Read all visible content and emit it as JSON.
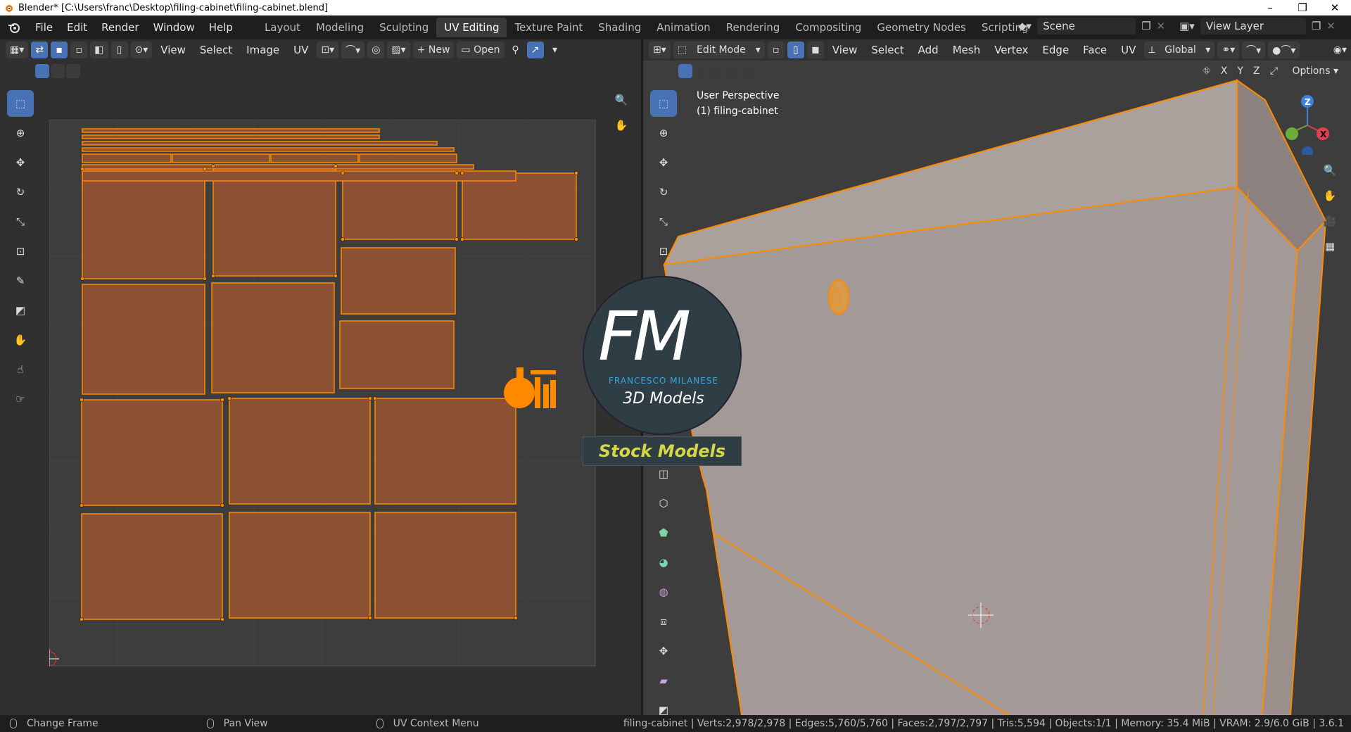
{
  "window": {
    "title": "Blender* [C:\\Users\\franc\\Desktop\\filing-cabinet\\filing-cabinet.blend]",
    "min": "–",
    "max": "❐",
    "close": "✕"
  },
  "menu": [
    "File",
    "Edit",
    "Render",
    "Window",
    "Help"
  ],
  "workspaces": [
    {
      "label": "Layout"
    },
    {
      "label": "Modeling"
    },
    {
      "label": "Sculpting"
    },
    {
      "label": "UV Editing",
      "active": true
    },
    {
      "label": "Texture Paint"
    },
    {
      "label": "Shading"
    },
    {
      "label": "Animation"
    },
    {
      "label": "Rendering"
    },
    {
      "label": "Compositing"
    },
    {
      "label": "Geometry Nodes"
    },
    {
      "label": "Scripting"
    }
  ],
  "workspace_add": "+",
  "scene": {
    "name": "Scene",
    "view_layer": "View Layer"
  },
  "uv_editor": {
    "menus": [
      "View",
      "Select",
      "Image",
      "UV"
    ],
    "new_label": "New",
    "open_label": "Open"
  },
  "viewport": {
    "mode": "Edit Mode",
    "menus": [
      "View",
      "Select",
      "Add",
      "Mesh",
      "Vertex",
      "Edge",
      "Face",
      "UV"
    ],
    "transform": "Global",
    "axes": [
      "X",
      "Y",
      "Z"
    ],
    "options": "Options",
    "perspective": "User Perspective",
    "object": "(1) filing-cabinet"
  },
  "watermark": {
    "logo_text": "FM",
    "name": "FRANCESCO MILANESE",
    "subtitle": "3D Models",
    "banner": "Stock Models"
  },
  "status": {
    "left1": "Change Frame",
    "left2": "Pan View",
    "left3": "UV Context Menu",
    "stats": "filing-cabinet | Verts:2,978/2,978 | Edges:5,760/5,760 | Faces:2,797/2,797 | Tris:5,594 | Objects:1/1 | Memory: 35.4 MiB | VRAM: 2.9/6.0 GiB | 3.6.1"
  },
  "colors": {
    "accent": "#4772b3",
    "uv_fill": "#8c5133",
    "uv_edge": "#ff8a00",
    "mesh": "#a39a97"
  }
}
